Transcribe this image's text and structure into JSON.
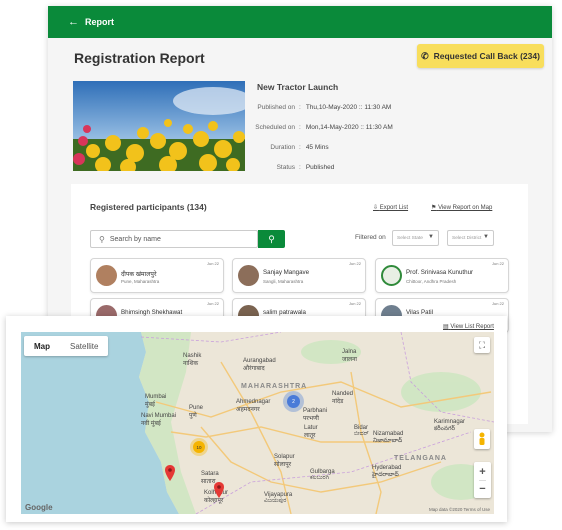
{
  "topbar": {
    "back_label": "Report"
  },
  "page": {
    "title": "Registration Report",
    "callback_label": "Requested Call Back (234)"
  },
  "event": {
    "title": "New Tractor Launch",
    "meta": [
      {
        "key": "Published on",
        "value": "Thu,10-May-2020 :: 11:30 AM"
      },
      {
        "key": "Scheduled on",
        "value": "Mon,14-May-2020 :: 11:30 AM"
      },
      {
        "key": "Duration",
        "value": "45 Mins"
      },
      {
        "key": "Status",
        "value": "Published"
      }
    ]
  },
  "participants": {
    "title": "Registered participants (134)",
    "export_label": "Export List",
    "view_map_label": "View Report on Map",
    "search_placeholder": "Search by name",
    "filtered_label": "Filtered on",
    "state_select": "Select State",
    "district_select": "Select District",
    "cards": [
      {
        "name": "दीपक खंमालपुरे",
        "location": "Pune, Maharashtra",
        "date": "Jun 22"
      },
      {
        "name": "Sanjay Mangave",
        "location": "Sangli, Maharashtra",
        "date": "Jun 22"
      },
      {
        "name": "Prof. Srinivasa Kunuthur",
        "location": "Chittoor, Andhra Pradesh",
        "date": "Jun 22"
      },
      {
        "name": "Bhimsingh Shekhawat",
        "location": "",
        "date": "Jun 22"
      },
      {
        "name": "salim patrawala",
        "location": "",
        "date": "Jun 22"
      },
      {
        "name": "Vilas Patil",
        "location": "",
        "date": "Jun 22"
      }
    ]
  },
  "map": {
    "view_list_label": "View List Report",
    "tab_map": "Map",
    "tab_satellite": "Satellite",
    "zoom_in": "+",
    "zoom_out": "−",
    "google": "Google",
    "footer": "Map data ©2020   Terms of Use",
    "cluster_blue": "2",
    "cluster_yellow": "10",
    "labels": {
      "nashik": "Nashik",
      "nashik_local": "नाशिक",
      "aurangabad": "Aurangabad",
      "aurangabad_local": "औरंगाबाद",
      "maharashtra": "MAHARASHTRA",
      "mumbai": "Mumbai",
      "mumbai_local": "मुंबई",
      "navi_mumbai": "Navi Mumbai",
      "navi_mumbai_local": "नवी मुंबई",
      "pune": "Pune",
      "pune_local": "पुणे",
      "ahmednagar": "Ahmednagar",
      "ahmednagar_local": "अहमदनगर",
      "nanded": "Nanded",
      "nanded_local": "नांदेड",
      "latur": "Latur",
      "latur_local": "लातूर",
      "solapur": "Solapur",
      "solapur_local": "सोलापूर",
      "satara": "Satara",
      "satara_local": "सातारा",
      "kolhapur": "Kolhapur",
      "kolhapur_local": "कोल्हापूर",
      "nizamabad": "Nizamabad",
      "nizamabad_local": "నిజామాబాద్",
      "karimnagar": "Karimnagar",
      "karimnagar_local": "కరీంనగర్",
      "telangana": "TELANGANA",
      "hyderabad": "Hyderabad",
      "hyderabad_local": "హైదరాబాద్",
      "gulbarga": "Gulbarga",
      "gulbarga_local": "ಕಲಬುರಗಿ",
      "vijayapura": "Vijayapura",
      "vijayapura_local": "ವಿಜಯಪುರ",
      "parbhani": "Parbhani",
      "parbhani_local": "परभणी",
      "jalna": "Jalna",
      "jalna_local": "जालना",
      "bidar": "Bidar",
      "bidar_local": "ಬೀದರ್"
    }
  }
}
